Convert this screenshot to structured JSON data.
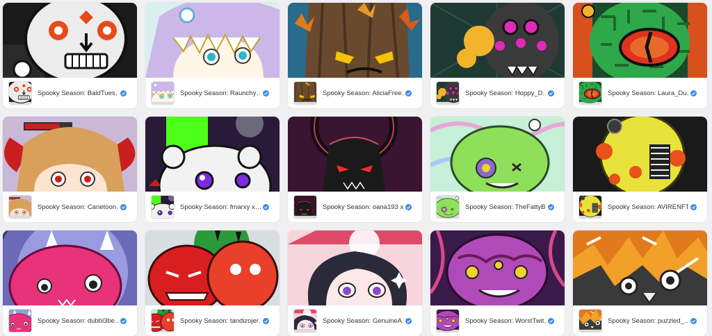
{
  "gallery": {
    "items": [
      {
        "name": "Spooky Season: BaldTues…",
        "art": "skull-robot",
        "bg": "#1a1a1a",
        "accent": "#e84a1c"
      },
      {
        "name": "Spooky Season: Raunchy…",
        "art": "shark-hood",
        "bg": "#cbb8e8",
        "accent": "#2db4c8"
      },
      {
        "name": "Spooky Season: AliciaFree…",
        "art": "tree-face",
        "bg": "#3a2a1a",
        "accent": "#f5c400"
      },
      {
        "name": "Spooky Season: Hoppy_D…",
        "art": "spider-eyes",
        "bg": "#1f3a32",
        "accent": "#e02ab8"
      },
      {
        "name": "Spooky Season: Laura_Du…",
        "art": "dragon-eye",
        "bg": "#2ea84a",
        "accent": "#e0321c"
      },
      {
        "name": "Spooky Season: Canetoon…",
        "art": "horned-girl",
        "bg": "#c9b8d6",
        "accent": "#c81e1e"
      },
      {
        "name": "Spooky Season: fmarxy x…",
        "art": "ghost-bear",
        "bg": "#2a1a3a",
        "accent": "#4eff1a"
      },
      {
        "name": "Spooky Season: oana193 x…",
        "art": "dark-demon",
        "bg": "#3a1430",
        "accent": "#ff2a2a"
      },
      {
        "name": "Spooky Season: TheFattyB…",
        "art": "zombie-blob",
        "bg": "#c6f0d8",
        "accent": "#8ee05a"
      },
      {
        "name": "Spooky Season: AVIRENFT…",
        "art": "yellow-beast",
        "bg": "#1a1a1a",
        "accent": "#e8e23a"
      },
      {
        "name": "Spooky Season: dubbl3be…",
        "art": "pink-monster",
        "bg": "#c8d0ea",
        "accent": "#e8327a"
      },
      {
        "name": "Spooky Season: tandizojer…",
        "art": "red-heads",
        "bg": "#d8dde0",
        "accent": "#d81e1e"
      },
      {
        "name": "Spooky Season: GenuineA…",
        "art": "anime-witch",
        "bg": "#f7d4dc",
        "accent": "#e04a6a"
      },
      {
        "name": "Spooky Season: WorstTwit…",
        "art": "brain-monster",
        "bg": "#3a1a4a",
        "accent": "#b04ab8"
      },
      {
        "name": "Spooky Season: puzzled_…",
        "art": "fire-owl",
        "bg": "#e07a1c",
        "accent": "#3a3a3a"
      }
    ]
  }
}
